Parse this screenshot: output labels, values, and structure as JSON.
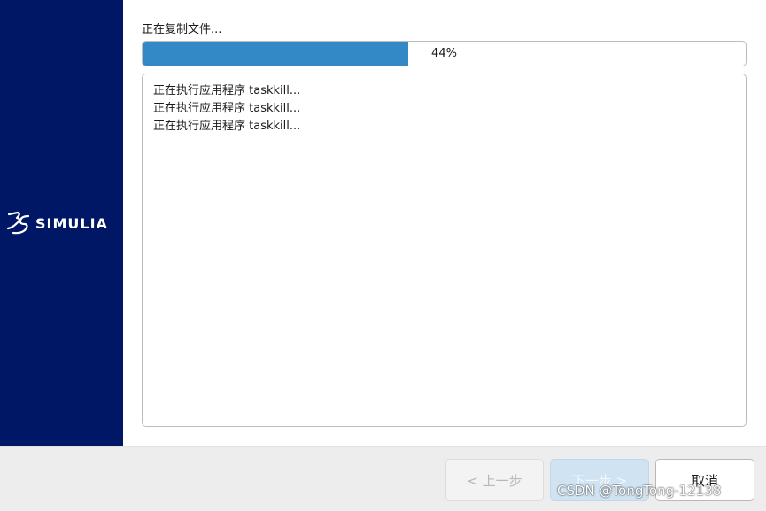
{
  "brand": {
    "logo_icon": "3ds-logo-icon",
    "name": "SIMULIA",
    "sidebar_color": "#001766"
  },
  "status": {
    "label": "正在复制文件...",
    "progress_percent": 44,
    "progress_text": "44%",
    "fill_color": "#3389c6"
  },
  "log": {
    "lines": [
      "正在执行应用程序 taskkill...",
      "正在执行应用程序 taskkill...",
      "正在执行应用程序 taskkill..."
    ]
  },
  "buttons": {
    "back_label": "< 上一步",
    "next_label": "下一步 >",
    "cancel_label": "取消"
  },
  "watermark": "CSDN @TongTong-12138"
}
